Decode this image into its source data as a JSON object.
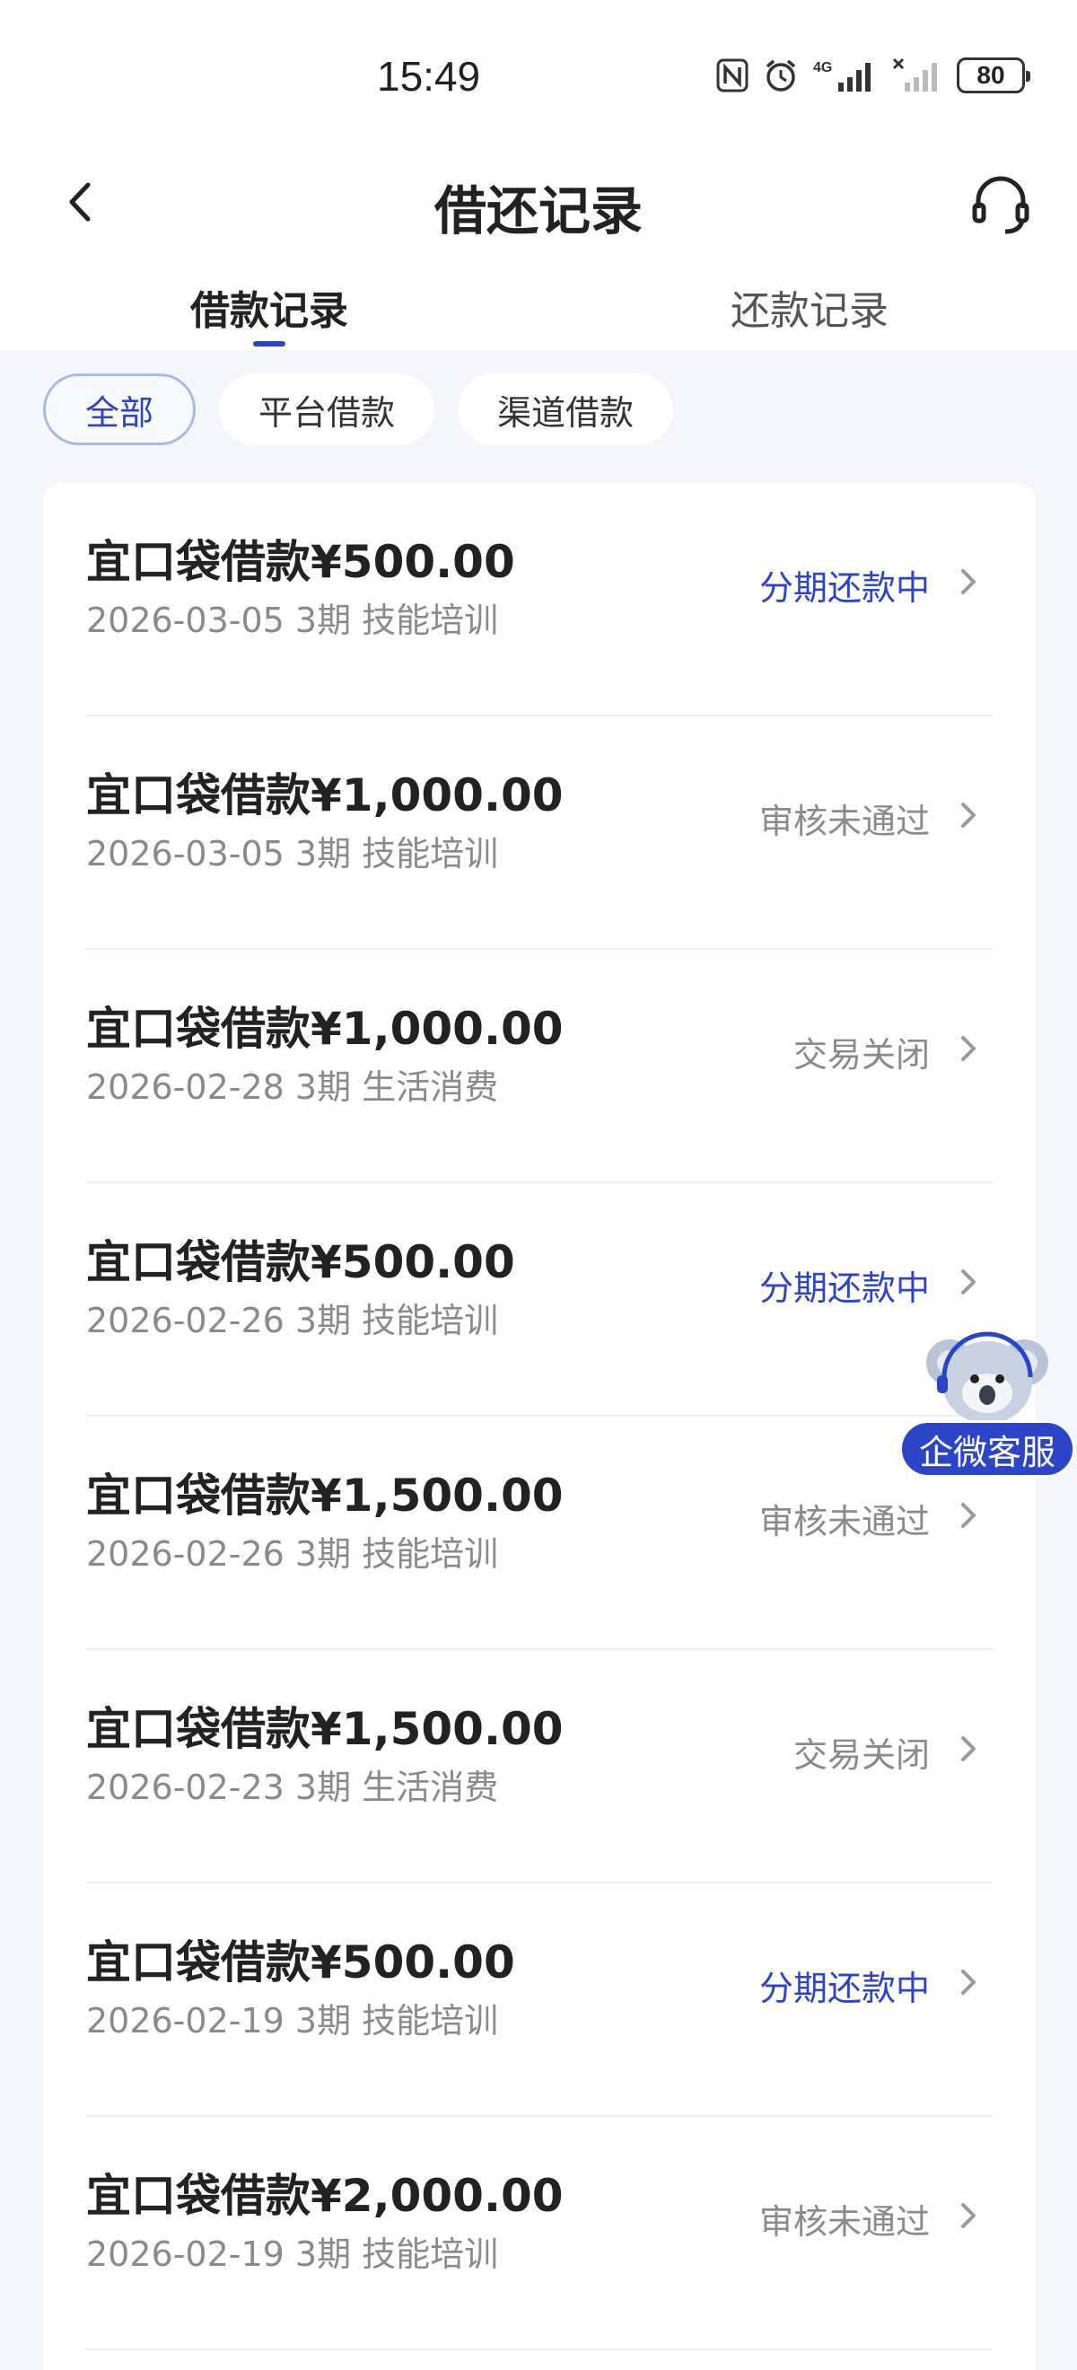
{
  "status_bar": {
    "time": "15:49",
    "signal_label": "4G",
    "battery": "80",
    "icons": [
      "nfc-icon",
      "alarm-icon",
      "signal-4g-icon",
      "signal-no-service-icon",
      "battery-icon"
    ]
  },
  "header": {
    "title": "借还记录",
    "back_icon": "chevron-left-icon",
    "service_icon": "headset-icon"
  },
  "tabs": [
    {
      "label": "借款记录",
      "active": true
    },
    {
      "label": "还款记录",
      "active": false
    }
  ],
  "filters": [
    {
      "label": "全部",
      "active": true
    },
    {
      "label": "平台借款",
      "active": false
    },
    {
      "label": "渠道借款",
      "active": false
    }
  ],
  "colors": {
    "accent": "#2b44c8",
    "status_active": "#2b44c8",
    "status_muted": "#8a8a8a"
  },
  "loans": [
    {
      "title": "宜口袋借款¥500.00",
      "subtitle": "2026-03-05 3期  技能培训",
      "status": "分期还款中",
      "status_type": "active"
    },
    {
      "title": "宜口袋借款¥1,000.00",
      "subtitle": "2026-03-05 3期  技能培训",
      "status": "审核未通过",
      "status_type": "muted"
    },
    {
      "title": "宜口袋借款¥1,000.00",
      "subtitle": "2026-02-28 3期  生活消费",
      "status": "交易关闭",
      "status_type": "muted"
    },
    {
      "title": "宜口袋借款¥500.00",
      "subtitle": "2026-02-26 3期  技能培训",
      "status": "分期还款中",
      "status_type": "active"
    },
    {
      "title": "宜口袋借款¥1,500.00",
      "subtitle": "2026-02-26 3期  技能培训",
      "status": "审核未通过",
      "status_type": "muted"
    },
    {
      "title": "宜口袋借款¥1,500.00",
      "subtitle": "2026-02-23 3期  生活消费",
      "status": "交易关闭",
      "status_type": "muted"
    },
    {
      "title": "宜口袋借款¥500.00",
      "subtitle": "2026-02-19 3期  技能培训",
      "status": "分期还款中",
      "status_type": "active"
    },
    {
      "title": "宜口袋借款¥2,000.00",
      "subtitle": "2026-02-19 3期  技能培训",
      "status": "审核未通过",
      "status_type": "muted"
    }
  ],
  "floating_service": {
    "label": "企微客服",
    "mascot_icon": "koala-mascot-icon"
  }
}
